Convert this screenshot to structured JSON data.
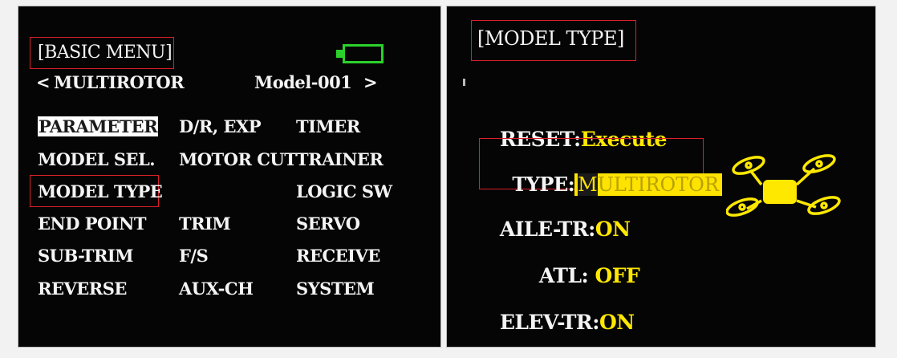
{
  "left": {
    "title": "[BASIC MENU]",
    "nav_prev": "<",
    "model_type": "MULTIROTOR",
    "model_name": "Model-001",
    "nav_next": ">",
    "battery_color": "#2bd12b",
    "menu": [
      [
        "PARAMETER",
        "D/R, EXP",
        "TIMER"
      ],
      [
        "MODEL SEL.",
        "MOTOR CUT",
        "TRAINER"
      ],
      [
        "MODEL TYPE",
        "",
        "LOGIC SW"
      ],
      [
        "END POINT",
        "TRIM",
        "SERVO"
      ],
      [
        "SUB-TRIM",
        "F/S",
        "RECEIVE"
      ],
      [
        "REVERSE",
        "AUX-CH",
        "SYSTEM"
      ]
    ]
  },
  "right": {
    "title": "[MODEL TYPE]",
    "reset_label": "RESET:",
    "reset_value": "Execute",
    "type_label": "TYPE:",
    "type_value_first": "M",
    "type_value_rest": "ULTIROTOR",
    "aile_label": "AILE-TR:",
    "aile_value": "ON",
    "atl_label": "ATL:",
    "atl_value": "OFF",
    "elev_label": "ELEV-TR:",
    "elev_value": "ON",
    "icon": "quadcopter-icon",
    "accent_color": "#ffe800",
    "highlight_color": "#d9202a"
  }
}
